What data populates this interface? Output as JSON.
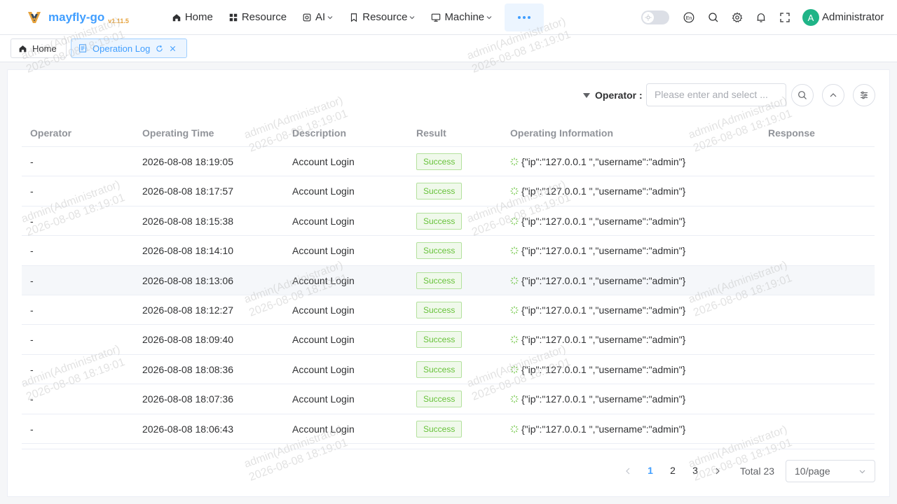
{
  "app": {
    "name": "mayfly-go",
    "version": "v1.11.5"
  },
  "nav": {
    "items": [
      {
        "label": "Home",
        "icon": "home-icon",
        "dropdown": false
      },
      {
        "label": "Resource",
        "icon": "grid-icon",
        "dropdown": false
      },
      {
        "label": "AI",
        "icon": "ai-icon",
        "dropdown": true
      },
      {
        "label": "Resource",
        "icon": "bookmark-icon",
        "dropdown": true
      },
      {
        "label": "Machine",
        "icon": "monitor-icon",
        "dropdown": true
      }
    ],
    "more_icon": "more-dots-icon"
  },
  "header": {
    "language_label": "En",
    "user": {
      "avatar_letter": "A",
      "name": "Administrator"
    },
    "accent_color": "#409eff"
  },
  "tabs": [
    {
      "label": "Home",
      "icon": "home-icon",
      "active": false
    },
    {
      "label": "Operation Log",
      "icon": "document-icon",
      "active": true
    }
  ],
  "filter": {
    "label": "Operator :",
    "placeholder": "Please enter and select ..."
  },
  "table": {
    "columns": [
      "Operator",
      "Operating Time",
      "Description",
      "Result",
      "Operating Information",
      "Response"
    ],
    "rows": [
      {
        "operator": "-",
        "time": "2026-08-08 18:19:05",
        "description": "Account Login",
        "result": "Success",
        "info": "{\"ip\":\"127.0.0.1 \",\"username\":\"admin\"}",
        "response": ""
      },
      {
        "operator": "-",
        "time": "2026-08-08 18:17:57",
        "description": "Account Login",
        "result": "Success",
        "info": "{\"ip\":\"127.0.0.1 \",\"username\":\"admin\"}",
        "response": ""
      },
      {
        "operator": "-",
        "time": "2026-08-08 18:15:38",
        "description": "Account Login",
        "result": "Success",
        "info": "{\"ip\":\"127.0.0.1 \",\"username\":\"admin\"}",
        "response": ""
      },
      {
        "operator": "-",
        "time": "2026-08-08 18:14:10",
        "description": "Account Login",
        "result": "Success",
        "info": "{\"ip\":\"127.0.0.1 \",\"username\":\"admin\"}",
        "response": ""
      },
      {
        "operator": "-",
        "time": "2026-08-08 18:13:06",
        "description": "Account Login",
        "result": "Success",
        "info": "{\"ip\":\"127.0.0.1 \",\"username\":\"admin\"}",
        "response": ""
      },
      {
        "operator": "-",
        "time": "2026-08-08 18:12:27",
        "description": "Account Login",
        "result": "Success",
        "info": "{\"ip\":\"127.0.0.1 \",\"username\":\"admin\"}",
        "response": ""
      },
      {
        "operator": "-",
        "time": "2026-08-08 18:09:40",
        "description": "Account Login",
        "result": "Success",
        "info": "{\"ip\":\"127.0.0.1 \",\"username\":\"admin\"}",
        "response": ""
      },
      {
        "operator": "-",
        "time": "2026-08-08 18:08:36",
        "description": "Account Login",
        "result": "Success",
        "info": "{\"ip\":\"127.0.0.1 \",\"username\":\"admin\"}",
        "response": ""
      },
      {
        "operator": "-",
        "time": "2026-08-08 18:07:36",
        "description": "Account Login",
        "result": "Success",
        "info": "{\"ip\":\"127.0.0.1 \",\"username\":\"admin\"}",
        "response": ""
      },
      {
        "operator": "-",
        "time": "2026-08-08 18:06:43",
        "description": "Account Login",
        "result": "Success",
        "info": "{\"ip\":\"127.0.0.1 \",\"username\":\"admin\"}",
        "response": ""
      }
    ],
    "success_color": "#67c23a"
  },
  "pagination": {
    "pages": [
      "1",
      "2",
      "3"
    ],
    "current": "1",
    "total_label": "Total 23",
    "page_size": "10/page"
  },
  "watermark": {
    "line1": "admin(Administrator)",
    "line2": "2026-08-08 18:19:01"
  }
}
